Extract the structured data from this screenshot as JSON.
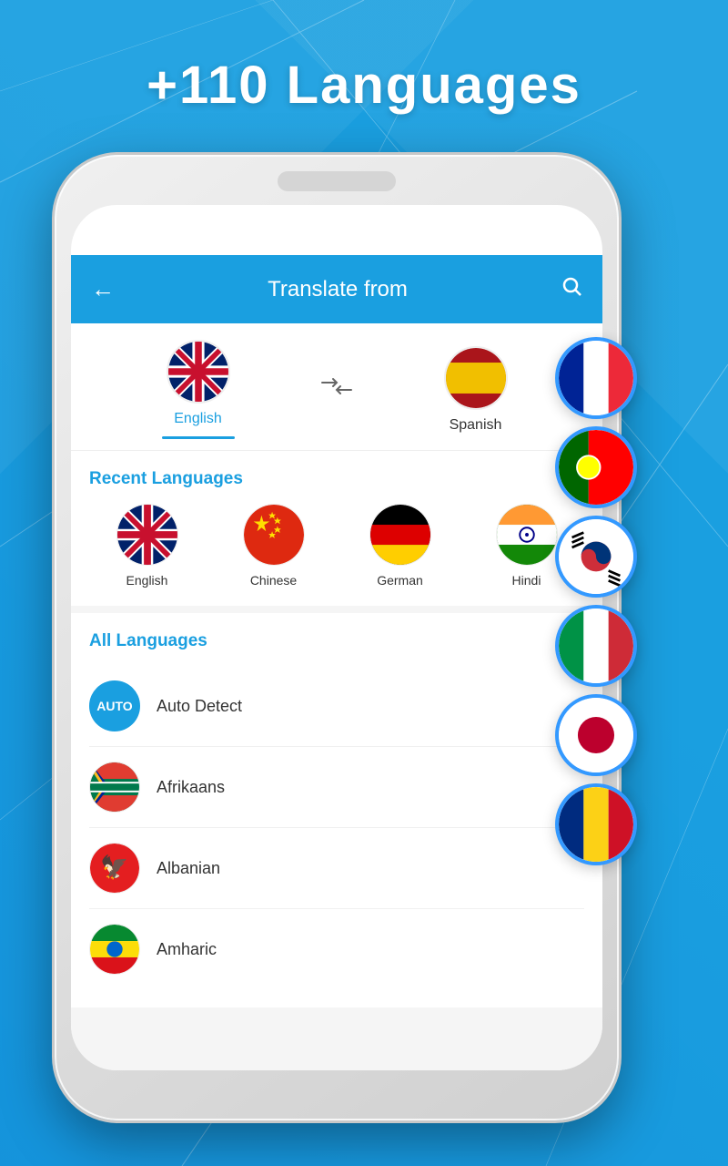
{
  "page": {
    "title": "+110 Languages",
    "background_color": "#1a9fe0"
  },
  "header": {
    "title": "Translate from",
    "back_label": "←",
    "search_label": "🔍"
  },
  "language_bar": {
    "from_language": "English",
    "to_language": "Spanish",
    "swap_label": "⇄"
  },
  "recent_section": {
    "title": "Recent Languages",
    "languages": [
      {
        "name": "English",
        "flag": "uk"
      },
      {
        "name": "Chinese",
        "flag": "china"
      },
      {
        "name": "German",
        "flag": "germany"
      },
      {
        "name": "Hindi",
        "flag": "india"
      }
    ]
  },
  "all_languages_section": {
    "title": "All Languages",
    "languages": [
      {
        "name": "Auto Detect",
        "flag": "auto"
      },
      {
        "name": "Afrikaans",
        "flag": "sa"
      },
      {
        "name": "Albanian",
        "flag": "albania"
      },
      {
        "name": "Amharic",
        "flag": "ethiopia"
      }
    ]
  },
  "floating_flags": [
    {
      "name": "France",
      "flag": "france"
    },
    {
      "name": "Portugal",
      "flag": "portugal"
    },
    {
      "name": "Korea",
      "flag": "korea"
    },
    {
      "name": "Italy",
      "flag": "italy"
    },
    {
      "name": "Japan",
      "flag": "japan"
    },
    {
      "name": "Romania",
      "flag": "romania"
    }
  ]
}
